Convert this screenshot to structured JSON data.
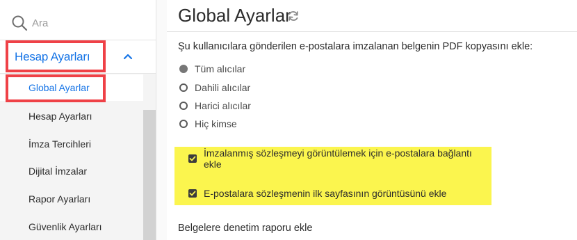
{
  "search": {
    "placeholder": "Ara"
  },
  "sidebar": {
    "section_label": "Hesap Ayarları",
    "items": [
      {
        "label": "Global Ayarlar",
        "active": true
      },
      {
        "label": "Hesap Ayarları"
      },
      {
        "label": "İmza Tercihleri"
      },
      {
        "label": "Dijital İmzalar"
      },
      {
        "label": "Rapor Ayarları"
      },
      {
        "label": "Güvenlik Ayarları"
      }
    ]
  },
  "main": {
    "title": "Global Ayarlar",
    "question": "Şu kullanıcılara gönderilen e-postalara imzalanan belgenin PDF kopyasını ekle:",
    "recipients": [
      {
        "label": "Tüm alıcılar",
        "checked": true
      },
      {
        "label": "Dahili alıcılar",
        "checked": false
      },
      {
        "label": "Harici alıcılar",
        "checked": false
      },
      {
        "label": "Hiç kimse",
        "checked": false
      }
    ],
    "options": [
      {
        "label": "İmzalanmış sözleşmeyi görüntülemek için e-postalara bağlantı ekle",
        "checked": true
      },
      {
        "label": "E-postalara sözleşmenin ilk sayfasının görüntüsünü ekle",
        "checked": true
      }
    ],
    "audit_label": "Belgelere denetim raporu ekle"
  },
  "colors": {
    "accent": "#1473e6",
    "annotation_red": "#ef4147",
    "highlight_yellow": "#fbf54e"
  },
  "icons": {
    "search": "search-icon",
    "collapse": "chevron-up-icon",
    "refresh": "refresh-icon"
  }
}
